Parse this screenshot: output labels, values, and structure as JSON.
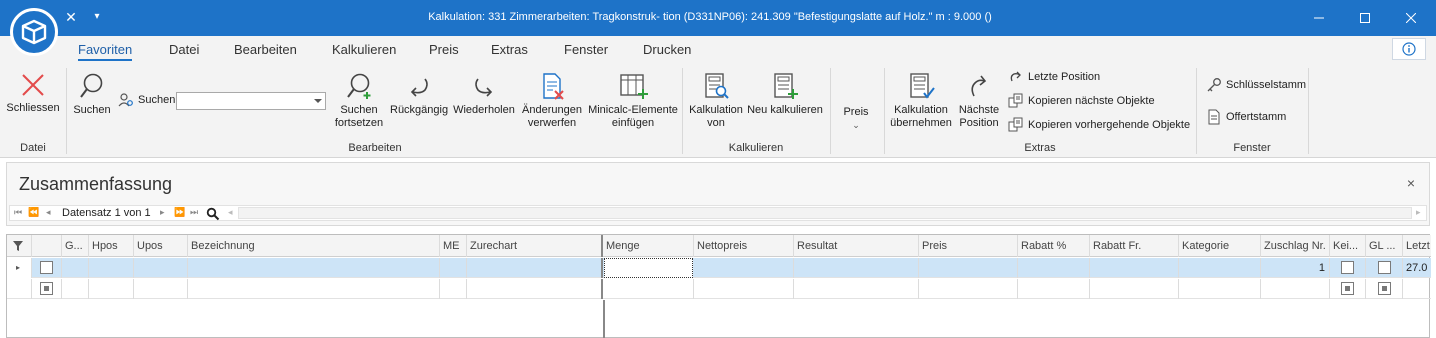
{
  "window": {
    "title": "Kalkulation: 331 Zimmerarbeiten: Tragkonstruk- tion (D331NP06): 241.309   \"Befestigungslatte auf Holz.\" m     :        9.000 ()"
  },
  "ribbon_tabs": [
    "Favoriten",
    "Datei",
    "Bearbeiten",
    "Kalkulieren",
    "Preis",
    "Extras",
    "Fenster",
    "Drucken"
  ],
  "ribbon": {
    "schliessen": "Schliessen",
    "suchen": "Suchen",
    "suchen_label": "Suchen",
    "suchen_value": "",
    "suchen_fortsetzen_1": "Suchen",
    "suchen_fortsetzen_2": "fortsetzen",
    "rueckgaengig": "Rückgängig",
    "wiederholen": "Wiederholen",
    "aenderungen_1": "Änderungen",
    "aenderungen_2": "verwerfen",
    "minicalc_1": "Minicalc-Elemente",
    "minicalc_2": "einfügen",
    "kalkulation_von_1": "Kalkulation",
    "kalkulation_von_2": "von",
    "neu_kalkulieren": "Neu kalkulieren",
    "preis": "Preis",
    "kalk_uebernehmen_1": "Kalkulation",
    "kalk_uebernehmen_2": "übernehmen",
    "naechste_position_1": "Nächste",
    "naechste_position_2": "Position",
    "letzte_position": "Letzte Position",
    "kopieren_naechste": "Kopieren nächste Objekte",
    "kopieren_vorher": "Kopieren vorhergehende Objekte",
    "schluesselstamm": "Schlüsselstamm",
    "offertstamm": "Offertstamm",
    "groups": {
      "datei": "Datei",
      "bearbeiten": "Bearbeiten",
      "kalkulieren": "Kalkulieren",
      "extras": "Extras",
      "fenster": "Fenster"
    }
  },
  "panel": {
    "title": "Zusammenfassung",
    "close": "×",
    "record_nav": "Datensatz 1 von 1"
  },
  "grid": {
    "columns": [
      "G...",
      "Hpos",
      "Upos",
      "Bezeichnung",
      "ME",
      "Zurechart",
      "Menge",
      "Nettopreis",
      "Resultat",
      "Preis",
      "Rabatt %",
      "Rabatt Fr.",
      "Kategorie",
      "Zuschlag Nr.",
      "Kei...",
      "GL ...",
      "Letzt"
    ],
    "rows": [
      {
        "zuschlag_nr": "1",
        "letzt": "27.0"
      }
    ]
  },
  "colors": {
    "accent": "#1e73c8",
    "selected_row": "#cde4f7"
  }
}
